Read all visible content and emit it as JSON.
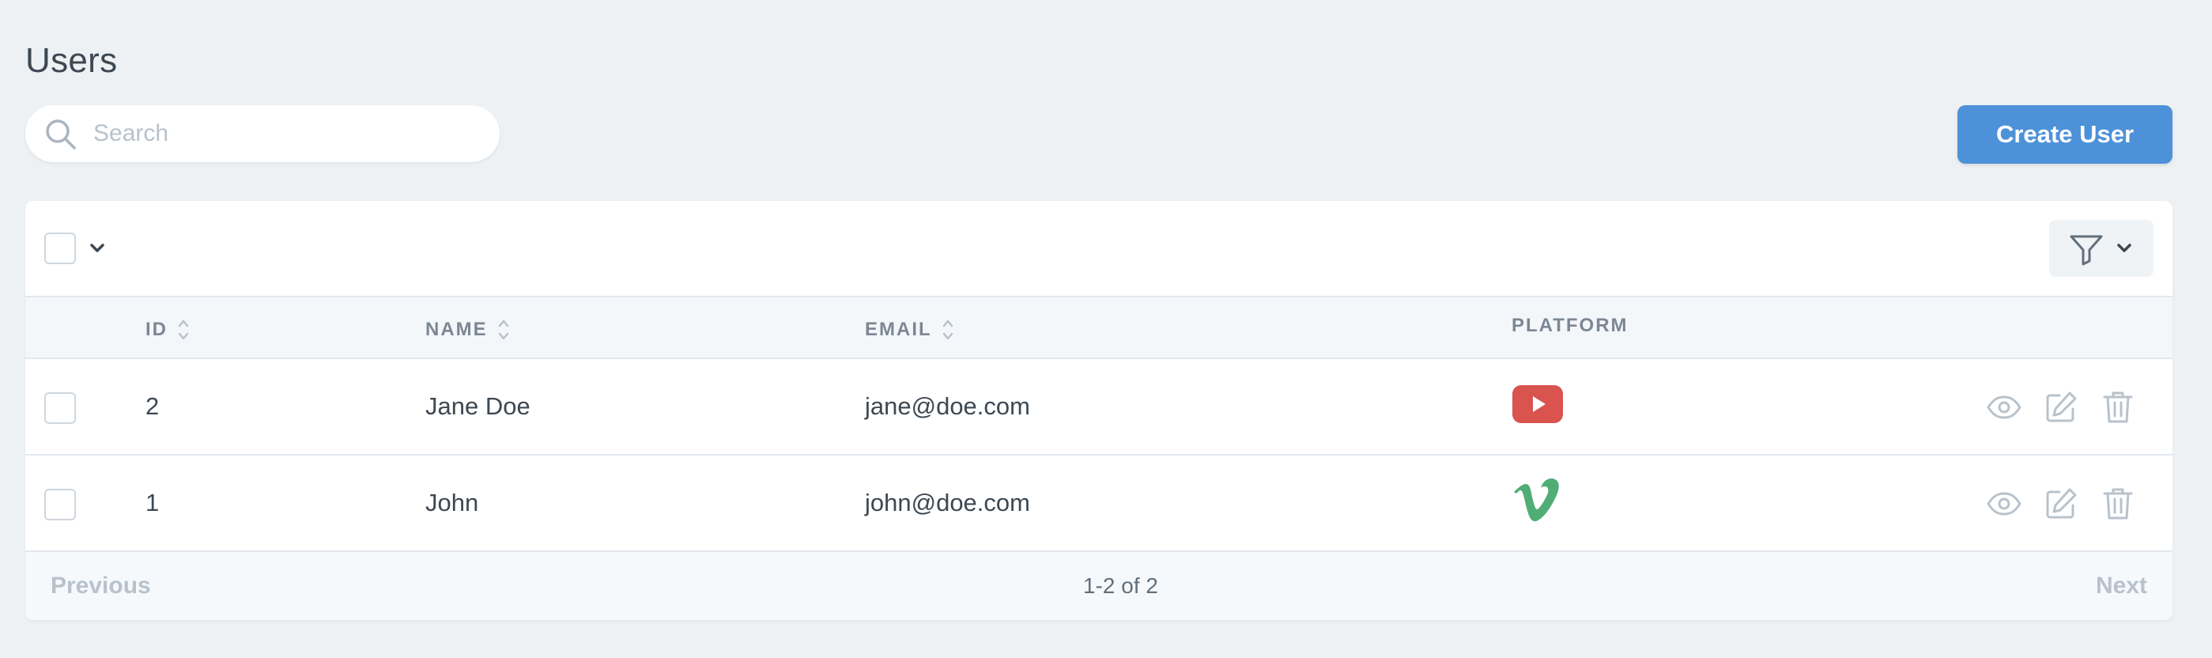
{
  "page": {
    "title": "Users"
  },
  "search": {
    "placeholder": "Search",
    "value": ""
  },
  "toolbar": {
    "create_label": "Create User"
  },
  "table": {
    "columns": {
      "id": "ID",
      "name": "NAME",
      "email": "EMAIL",
      "platform": "PLATFORM"
    },
    "rows": [
      {
        "id": "2",
        "name": "Jane Doe",
        "email": "jane@doe.com",
        "platform_icon": "youtube-icon"
      },
      {
        "id": "1",
        "name": "John",
        "email": "john@doe.com",
        "platform_icon": "vimeo-icon"
      }
    ]
  },
  "pagination": {
    "previous": "Previous",
    "summary": "1-2 of 2",
    "next": "Next"
  },
  "colors": {
    "accent": "#4d92d9",
    "youtube": "#d9534f",
    "vimeo": "#4fad75",
    "background": "#eef1f4"
  }
}
